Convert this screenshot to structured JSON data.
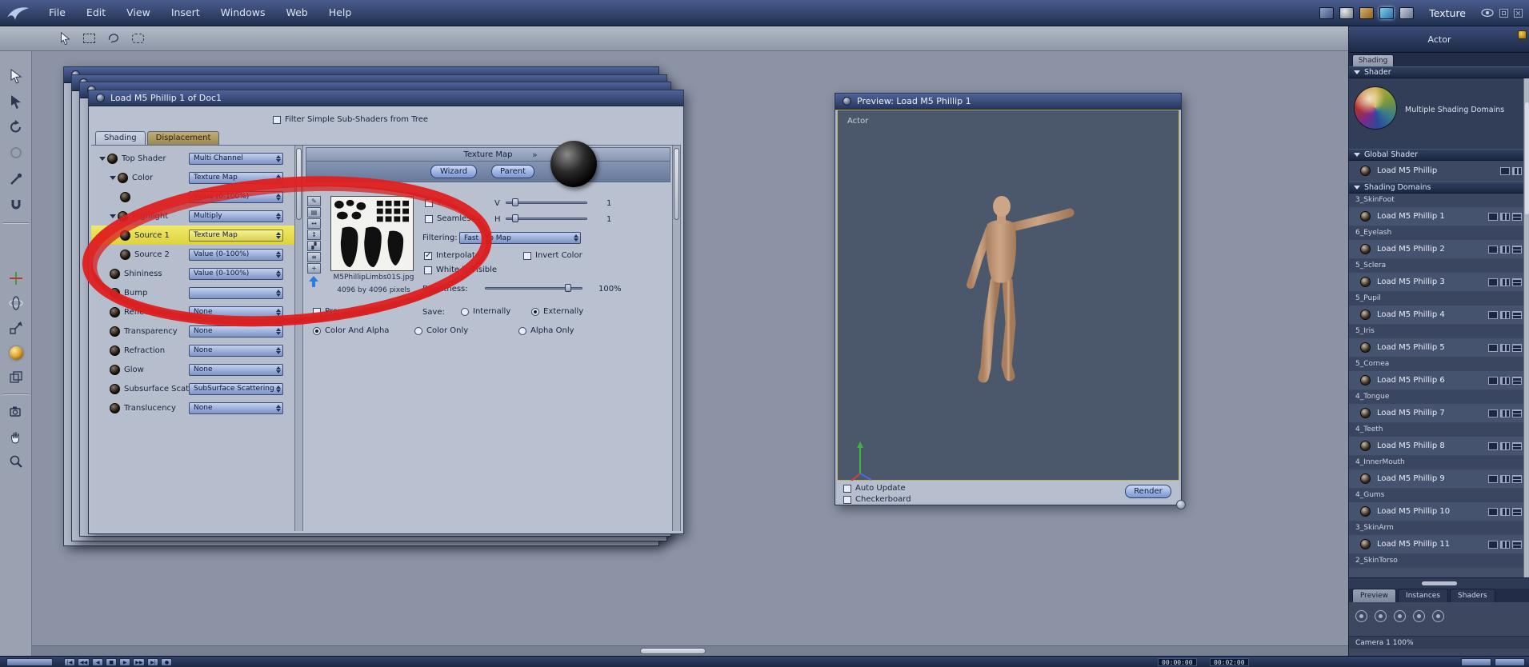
{
  "app": {
    "room_label": "Texture"
  },
  "menu": {
    "items": [
      "File",
      "Edit",
      "View",
      "Insert",
      "Windows",
      "Web",
      "Help"
    ]
  },
  "icons": {
    "double_chevron": "»",
    "pencil": "✎",
    "rows": "▤",
    "h_arrows": "↔",
    "v_arrows": "↕",
    "shade": "▞",
    "lines": "≡",
    "plus": "+"
  },
  "dialog": {
    "title": "Load M5 Phillip 1 of Doc1",
    "filter_label": "Filter Simple Sub-Shaders from Tree",
    "tabs": [
      {
        "label": "Shading",
        "active": true
      },
      {
        "label": "Displacement",
        "active": false
      }
    ],
    "tree": [
      {
        "label": "Top Shader",
        "value": "Multi Channel",
        "level": 0,
        "expanded": true
      },
      {
        "label": "Color",
        "value": "Texture Map",
        "level": 1,
        "expanded": true
      },
      {
        "label": "",
        "value": "Value (0-100%)",
        "level": 2
      },
      {
        "label": "Highlight",
        "value": "Multiply",
        "level": 1,
        "expanded": true
      },
      {
        "label": "Source 1",
        "value": "Texture Map",
        "level": 2,
        "selected": true
      },
      {
        "label": "Source 2",
        "value": "Value (0-100%)",
        "level": 2
      },
      {
        "label": "Shininess",
        "value": "Value (0-100%)",
        "level": 1
      },
      {
        "label": "Bump",
        "value": "",
        "level": 1
      },
      {
        "label": "Reflection",
        "value": "None",
        "level": 1
      },
      {
        "label": "Transparency",
        "value": "None",
        "level": 1
      },
      {
        "label": "Refraction",
        "value": "None",
        "level": 1
      },
      {
        "label": "Glow",
        "value": "None",
        "level": 1
      },
      {
        "label": "Subsurface Scat",
        "value": "SubSurface Scattering",
        "level": 1
      },
      {
        "label": "Translucency",
        "value": "None",
        "level": 1
      }
    ],
    "texmap": {
      "header": "Texture Map",
      "wizard": "Wizard",
      "parent": "Parent",
      "tile": "Tile",
      "seamlessly": "Seamlessly",
      "v_label": "V",
      "h_label": "H",
      "v_value": "1",
      "h_value": "1",
      "filtering_label": "Filtering:",
      "filtering_value": "Fast Mip Map",
      "interpolate": "Interpolate",
      "invert_color": "Invert Color",
      "white_visible": "White is Visible",
      "filename": "M5PhillipLimbs01S.jpg",
      "dimensions": "4096 by 4096 pixels",
      "brightness_label": "Brightness:",
      "brightness_value": "100%",
      "premultiply": "Premultiply?",
      "save_label": "Save:",
      "save_options": [
        "Internally",
        "Externally"
      ],
      "modes": [
        "Color And Alpha",
        "Color Only",
        "Alpha Only"
      ]
    }
  },
  "preview": {
    "title": "Preview: Load M5 Phillip 1",
    "viewport_label": "Actor",
    "auto_update_label": "Auto Update",
    "checkerboard_label": "Checkerboard",
    "render_label": "Render"
  },
  "sidebar": {
    "header_title": "Actor",
    "tab_label": "Shading",
    "shader_section_label": "Shader",
    "shader_summary": "Multiple Shading Domains",
    "global_section_label": "Global Shader",
    "global_item_label": "Load M5 Phillip",
    "domains_section_label": "Shading Domains",
    "domains": [
      {
        "group": "3_SkinFoot",
        "item": "Load M5 Phillip 1"
      },
      {
        "group": "6_Eyelash",
        "item": "Load M5 Phillip 2"
      },
      {
        "group": "5_Sclera",
        "item": "Load M5 Phillip 3"
      },
      {
        "group": "5_Pupil",
        "item": "Load M5 Phillip 4"
      },
      {
        "group": "5_Iris",
        "item": "Load M5 Phillip 5"
      },
      {
        "group": "5_Cornea",
        "item": "Load M5 Phillip 6"
      },
      {
        "group": "4_Tongue",
        "item": "Load M5 Phillip 7"
      },
      {
        "group": "4_Teeth",
        "item": "Load M5 Phillip 8"
      },
      {
        "group": "4_InnerMouth",
        "item": "Load M5 Phillip 9"
      },
      {
        "group": "4_Gums",
        "item": "Load M5 Phillip 10"
      },
      {
        "group": "3_SkinArm",
        "item": "Load M5 Phillip 11"
      },
      {
        "group": "2_SkinTorso",
        "item": ""
      }
    ],
    "bottom_tabs": [
      {
        "label": "Preview",
        "active": true
      },
      {
        "label": "Instances",
        "active": false
      },
      {
        "label": "Shaders",
        "active": false
      }
    ],
    "camera_label": "Camera 1 100%"
  },
  "timeline": {
    "current_time": "00:00:00",
    "end_time": "00:02:00",
    "buttons": [
      {
        "name": "skip-start-icon",
        "glyph": "|◀"
      },
      {
        "name": "frame-back-icon",
        "glyph": "◀◀"
      },
      {
        "name": "play-back-icon",
        "glyph": "◀"
      },
      {
        "name": "stop-icon",
        "glyph": "■"
      },
      {
        "name": "play-icon",
        "glyph": "▶"
      },
      {
        "name": "frame-forward-icon",
        "glyph": "▶▶"
      },
      {
        "name": "skip-end-icon",
        "glyph": "▶|"
      },
      {
        "name": "record-icon",
        "glyph": "●"
      }
    ]
  }
}
